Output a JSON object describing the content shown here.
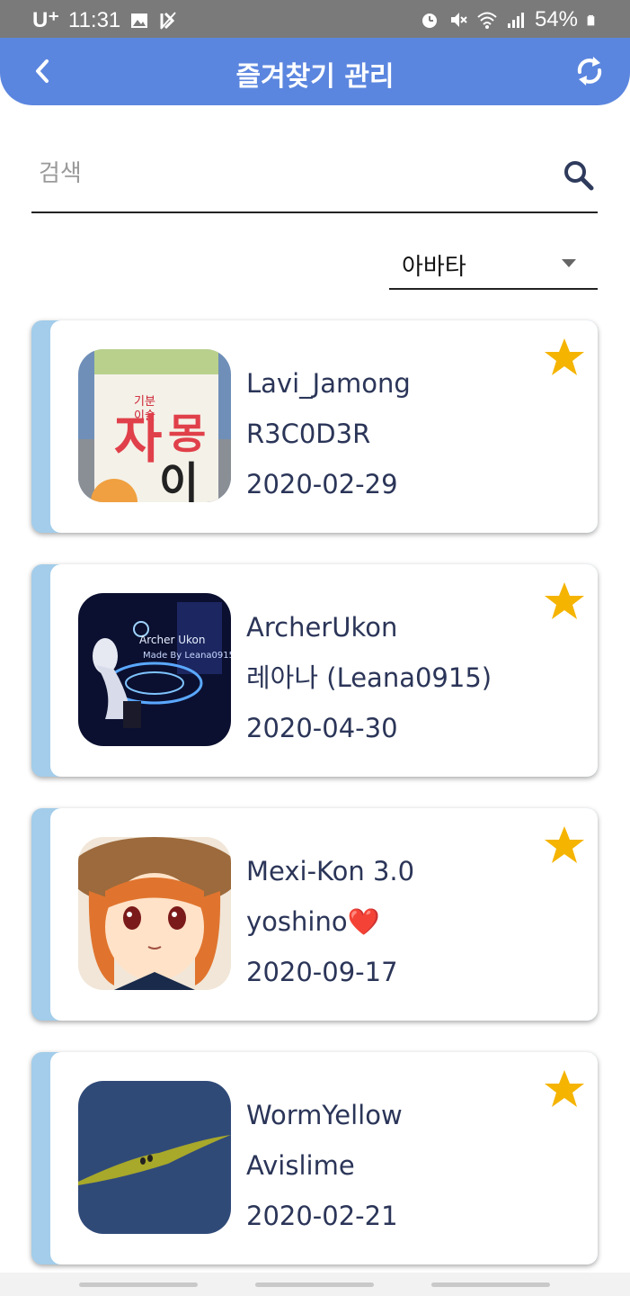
{
  "status_bar": {
    "carrier": "U⁺",
    "time": "11:31",
    "battery": "54%",
    "icons": [
      "image-icon",
      "no-charge-icon",
      "alarm-icon",
      "mute-icon",
      "wifi-icon",
      "signal-icon",
      "battery-icon"
    ]
  },
  "app_bar": {
    "title": "즐겨찾기 관리",
    "back_icon": "back-chevron-icon",
    "refresh_icon": "refresh-icon",
    "color": "#5b86df"
  },
  "search": {
    "placeholder": "검색",
    "value": "",
    "icon": "search-icon"
  },
  "filter": {
    "selected": "아바타",
    "icon": "dropdown-arrow-icon"
  },
  "favorites": [
    {
      "name": "Lavi_Jamong",
      "author": "R3C0D3R",
      "date": "2020-02-29",
      "starred": true
    },
    {
      "name": "ArcherUkon",
      "author": "레아나 (Leana0915)",
      "date": "2020-04-30",
      "starred": true
    },
    {
      "name": "Mexi-Kon 3.0",
      "author": "yoshino❤️",
      "date": "2020-09-17",
      "starred": true
    },
    {
      "name": "WormYellow",
      "author": "Avislime",
      "date": "2020-02-21",
      "starred": true
    }
  ],
  "colors": {
    "card_accent": "#a3cdea",
    "star": "#f5b400",
    "text": "#2b3558"
  }
}
